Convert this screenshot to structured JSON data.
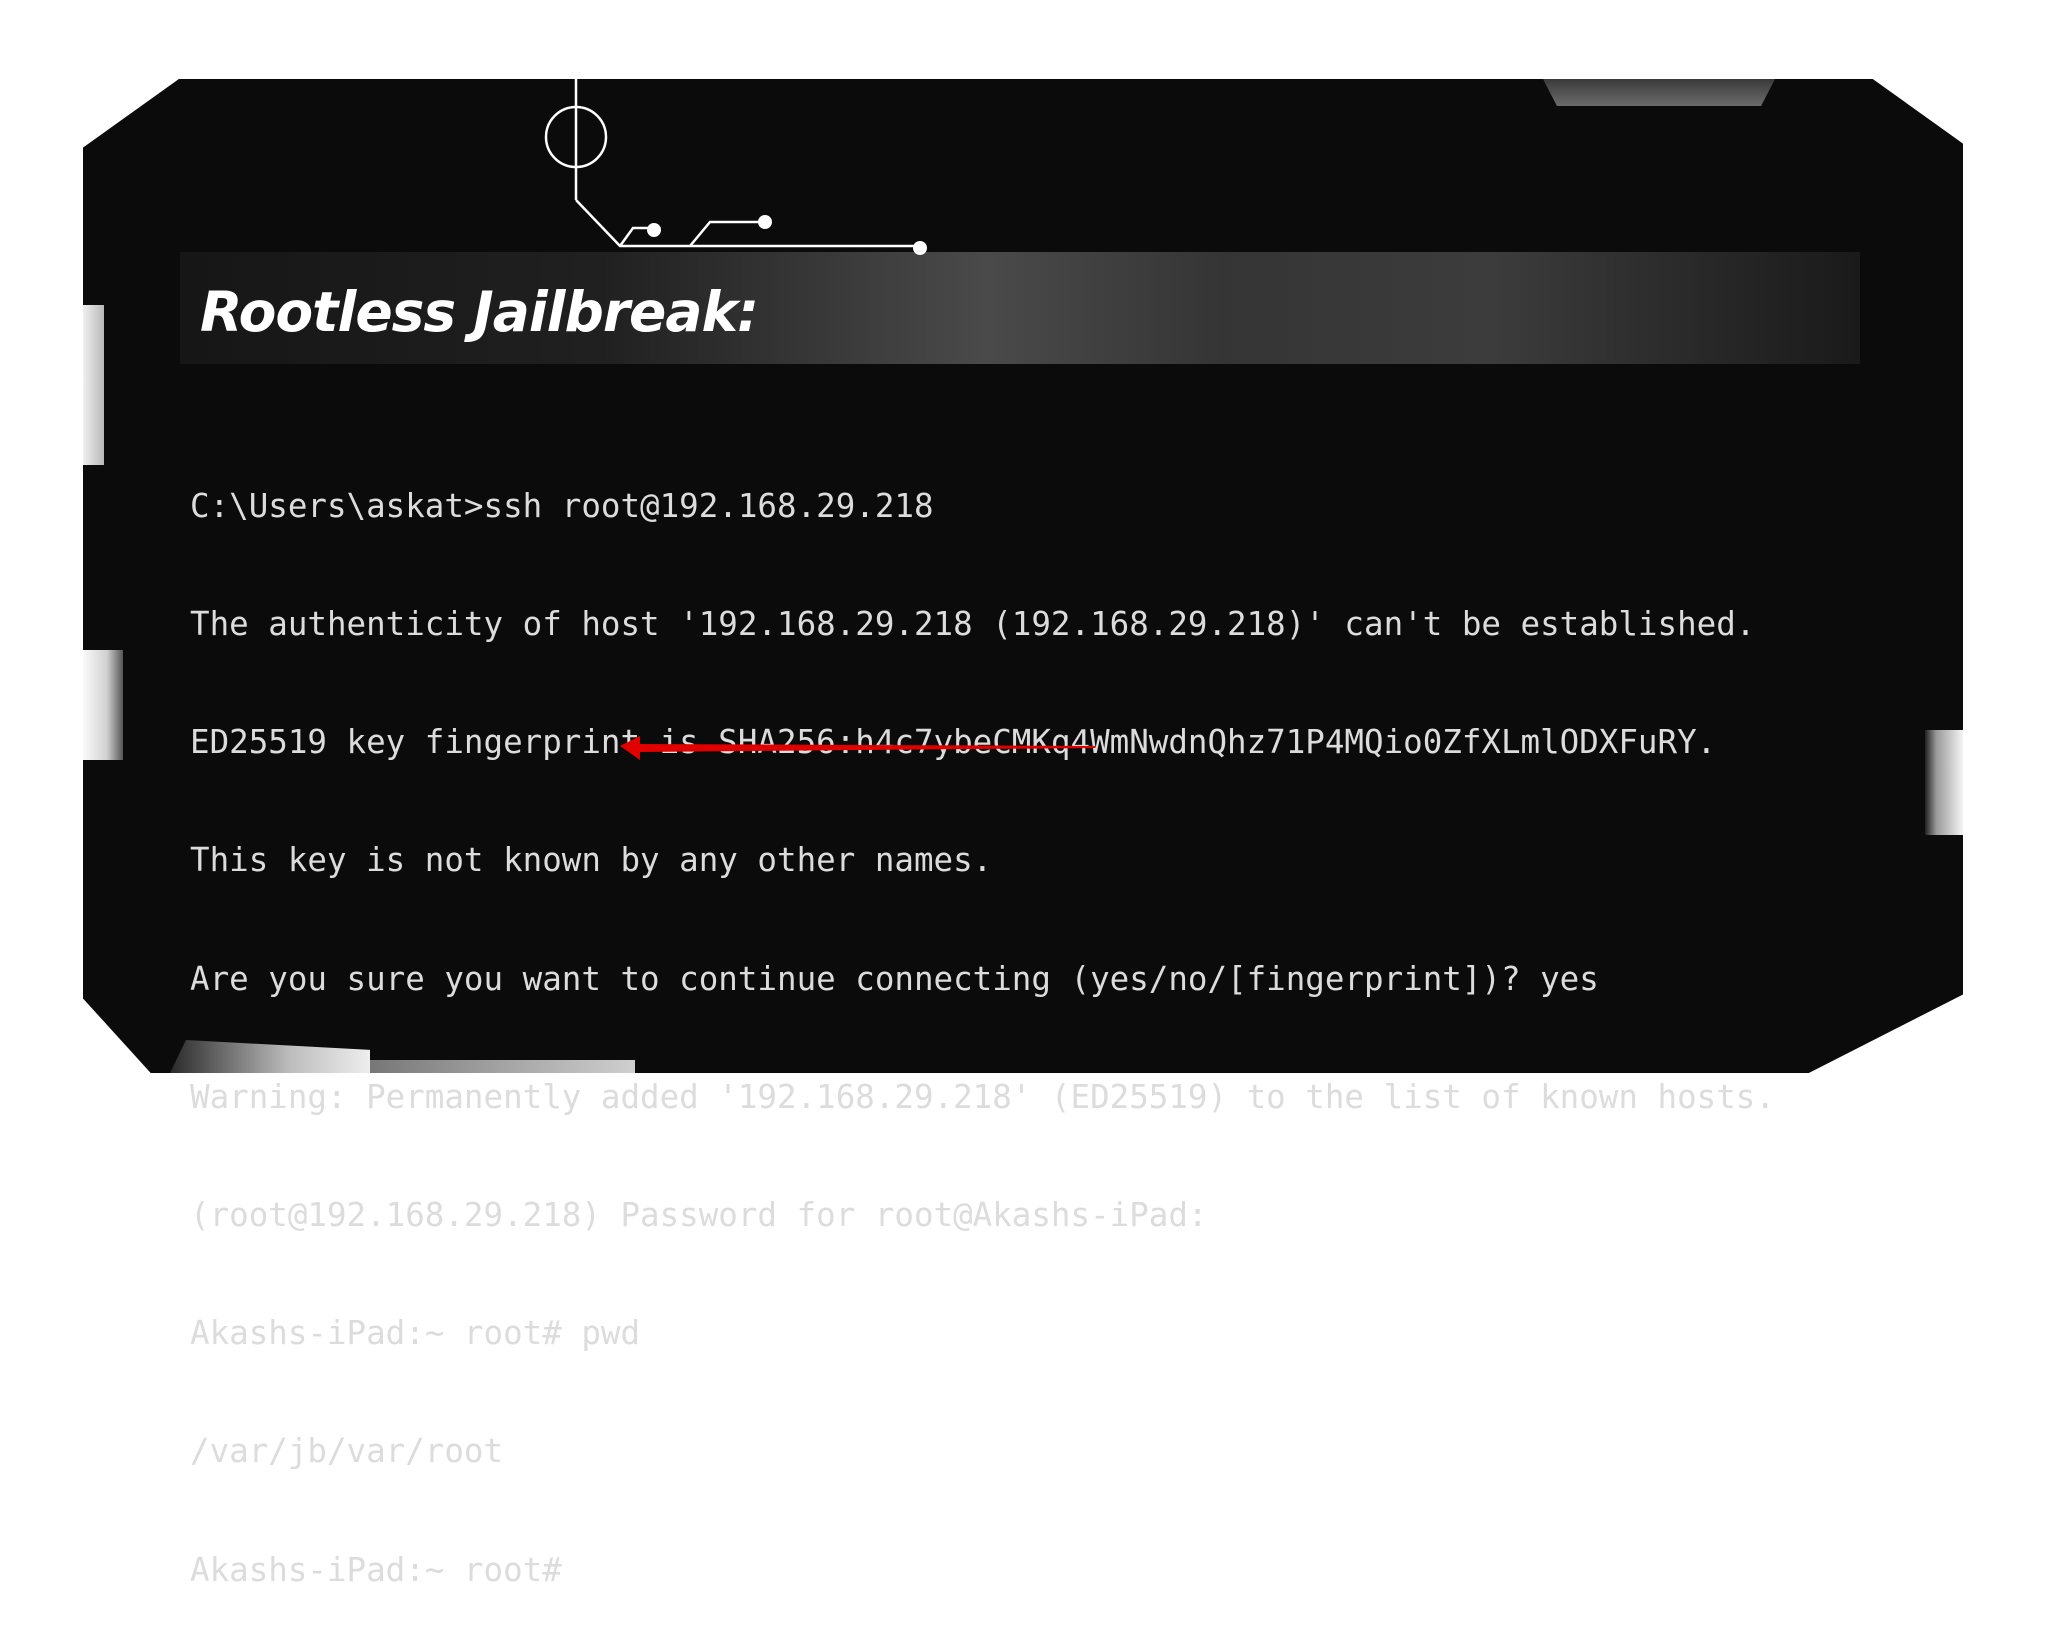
{
  "title": "Rootless Jailbreak:",
  "terminal": {
    "lines": [
      "C:\\Users\\askat>ssh root@192.168.29.218",
      "The authenticity of host '192.168.29.218 (192.168.29.218)' can't be established.",
      "ED25519 key fingerprint is SHA256:h4c7ybeCMKq4WmNwdnQhz71P4MQio0ZfXLmlODXFuRY.",
      "This key is not known by any other names.",
      "Are you sure you want to continue connecting (yes/no/[fingerprint])? yes",
      "Warning: Permanently added '192.168.29.218' (ED25519) to the list of known hosts.",
      "(root@192.168.29.218) Password for root@Akashs-iPad:",
      "Akashs-iPad:~ root# pwd",
      "/var/jb/var/root",
      "Akashs-iPad:~ root#"
    ]
  },
  "colors": {
    "panel": "#0b0b0b",
    "text": "#dcdcdc",
    "arrow": "#e00000",
    "circuit": "#ffffff"
  },
  "icons": {
    "circuit": "circuit-decoration",
    "arrow": "red-arrow-left"
  }
}
